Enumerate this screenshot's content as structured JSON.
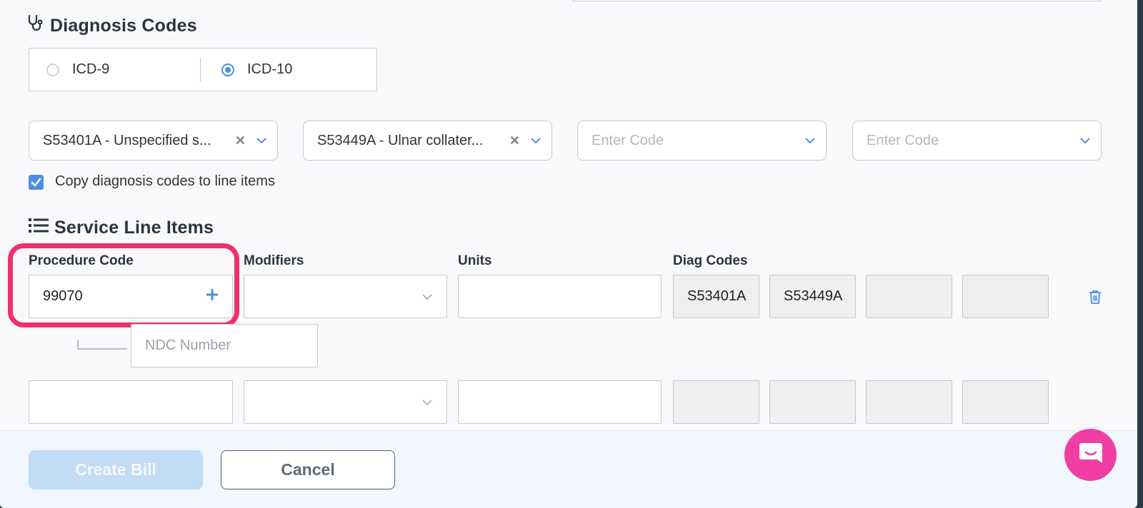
{
  "diagnosis": {
    "title": "Diagnosis Codes",
    "code_set": {
      "options": [
        {
          "label": "ICD-9",
          "checked": false
        },
        {
          "label": "ICD-10",
          "checked": true
        }
      ]
    },
    "codes": [
      {
        "value": "S53401A - Unspecified s...",
        "placeholder": "Enter Code",
        "clearable": true
      },
      {
        "value": "S53449A - Ulnar collater...",
        "placeholder": "Enter Code",
        "clearable": true
      },
      {
        "value": "",
        "placeholder": "Enter Code",
        "clearable": false
      },
      {
        "value": "",
        "placeholder": "Enter Code",
        "clearable": false
      }
    ],
    "copy_to_line_items": {
      "label": "Copy diagnosis codes to line items",
      "checked": true
    }
  },
  "service_lines": {
    "title": "Service Line Items",
    "headers": {
      "procedure_code": "Procedure Code",
      "modifiers": "Modifiers",
      "units": "Units",
      "diag_codes": "Diag Codes"
    },
    "rows": [
      {
        "procedure_code": "99070",
        "modifiers": "",
        "units": "",
        "diag_codes": [
          "S53401A",
          "S53449A",
          "",
          ""
        ],
        "ndc_placeholder": "NDC Number"
      },
      {
        "procedure_code": "",
        "modifiers": "",
        "units": "",
        "diag_codes": [
          "",
          "",
          "",
          ""
        ]
      }
    ]
  },
  "footer": {
    "create_bill_label": "Create Bill",
    "cancel_label": "Cancel"
  },
  "colors": {
    "accent": "#4a90e2",
    "highlight": "#f0306d",
    "chat": "#f03ea4",
    "primary_disabled": "#c2dcf6"
  },
  "icons": {
    "diagnosis": "stethoscope-icon",
    "service_lines": "list-icon",
    "add": "plus-icon",
    "delete": "trash-icon",
    "chat": "chat-icon"
  }
}
